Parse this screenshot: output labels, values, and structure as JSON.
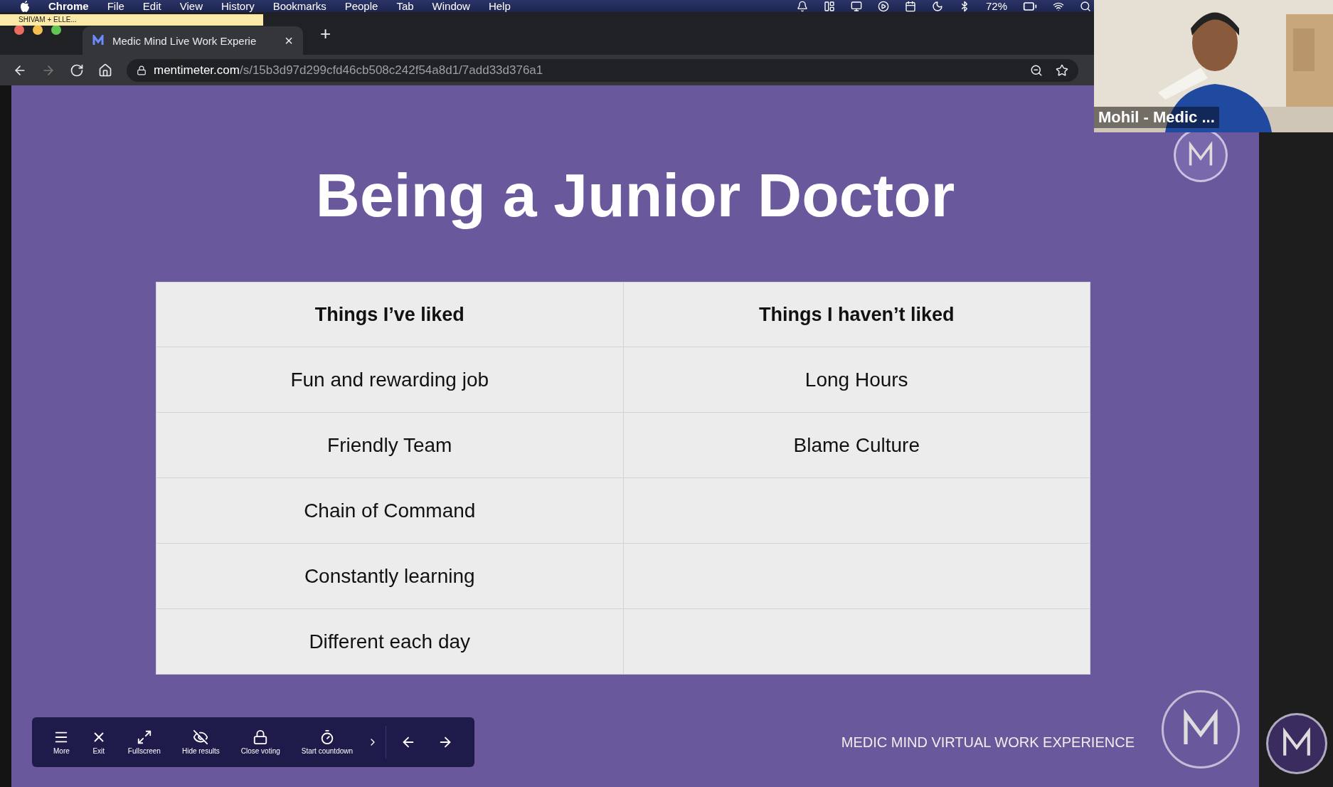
{
  "menu_bar": {
    "app": "Chrome",
    "items": [
      "File",
      "Edit",
      "View",
      "History",
      "Bookmarks",
      "People",
      "Tab",
      "Window",
      "Help"
    ],
    "battery": "72%"
  },
  "sticky_note": "SHIVAM + ELLE...",
  "browser": {
    "tab": {
      "title": "Medic Mind Live Work Experie",
      "close": "×"
    },
    "new_tab": "+",
    "url": {
      "domain": "mentimeter.com",
      "path": "/s/15b3d97d299cfd46cb508c242f54a8d1/7add33d376a1"
    }
  },
  "slide": {
    "title": "Being a Junior Doctor",
    "table": {
      "columns": [
        "Things I’ve liked",
        "Things I haven’t liked"
      ],
      "rows": [
        [
          "Fun and rewarding job",
          "Long Hours"
        ],
        [
          "Friendly Team",
          "Blame Culture"
        ],
        [
          "Chain of Command"
        ],
        [
          "Constantly learning"
        ],
        [
          "Different each day"
        ]
      ]
    },
    "toolbar": {
      "buttons": [
        {
          "label": "More",
          "kind": "menu"
        },
        {
          "label": "Exit",
          "kind": "close"
        },
        {
          "label": "Fullscreen",
          "kind": "expand"
        },
        {
          "label": "Hide results",
          "kind": "hide"
        },
        {
          "label": "Close voting",
          "kind": "lock"
        },
        {
          "label": "Start countdown",
          "kind": "timer"
        }
      ]
    },
    "footer": "MEDIC MIND VIRTUAL WORK EXPERIENCE"
  },
  "video": {
    "name": "Mohil - Medic ..."
  }
}
